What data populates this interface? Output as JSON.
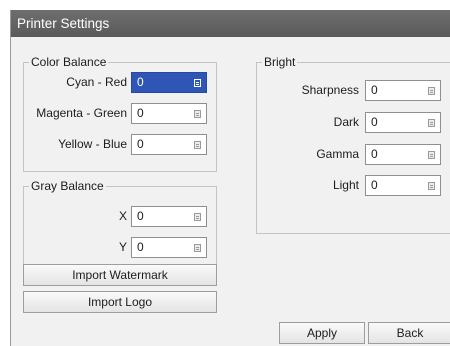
{
  "window": {
    "title": "Printer Settings"
  },
  "color_balance": {
    "title": "Color Balance",
    "fields": [
      {
        "label": "Cyan - Red",
        "value": "0"
      },
      {
        "label": "Magenta - Green",
        "value": "0"
      },
      {
        "label": "Yellow - Blue",
        "value": "0"
      }
    ]
  },
  "gray_balance": {
    "title": "Gray Balance",
    "fields": [
      {
        "label": "X",
        "value": "0"
      },
      {
        "label": "Y",
        "value": "0"
      }
    ]
  },
  "bright": {
    "title": "Bright",
    "fields": [
      {
        "label": "Sharpness",
        "value": "0"
      },
      {
        "label": "Dark",
        "value": "0"
      },
      {
        "label": "Gamma",
        "value": "0"
      },
      {
        "label": "Light",
        "value": "0"
      }
    ]
  },
  "buttons": {
    "import_watermark": "Import Watermark",
    "import_logo": "Import Logo",
    "apply": "Apply",
    "back": "Back"
  },
  "colors": {
    "titlebar": "#5f5f5f",
    "focus": "#2f56b6",
    "panel": "#f1f1f1"
  }
}
